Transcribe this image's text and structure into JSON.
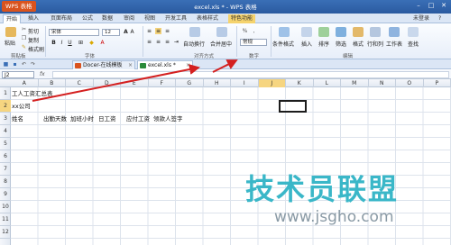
{
  "window": {
    "title": "excel.xls * - WPS 表格",
    "app_button": "WPS 表格"
  },
  "menu_tabs": [
    "开始",
    "插入",
    "页面布局",
    "公式",
    "数据",
    "审阅",
    "视图",
    "开发工具",
    "表格样式",
    "特色功能"
  ],
  "menu_right": [
    "未登录",
    "?"
  ],
  "ribbon": {
    "paste": "粘贴",
    "cut": "剪切",
    "copy": "复制",
    "format_painter": "格式刷",
    "font_name": "宋体",
    "font_size": "12",
    "wrap": "自动换行",
    "merge": "合并居中",
    "number_format": "常规",
    "cond_format": "条件格式",
    "insert_row": "插入",
    "sort": "排序",
    "filter": "筛选",
    "format": "格式",
    "row_col": "行和列",
    "sheet": "工作表",
    "find": "查找",
    "groups": {
      "clipboard": "剪贴板",
      "font": "字体",
      "align": "对齐方式",
      "number": "数字",
      "edit": "编辑"
    }
  },
  "doc_tabs": [
    {
      "label": "Docer-在线模板"
    },
    {
      "label": "excel.xls *"
    }
  ],
  "formula_bar": {
    "name_box": "J2",
    "fx": "fx",
    "value": ""
  },
  "columns": [
    "A",
    "B",
    "C",
    "D",
    "E",
    "F",
    "G",
    "H",
    "I",
    "J",
    "K",
    "L",
    "M",
    "N",
    "O",
    "P"
  ],
  "rows": [
    "1",
    "2",
    "3",
    "4",
    "5",
    "6",
    "7",
    "8",
    "9",
    "10",
    "11",
    "12"
  ],
  "cells": {
    "A1": "工人工资汇总表",
    "A2": "xx公司",
    "A3": "姓名",
    "B3": "出勤天数",
    "C3": "加班小时",
    "D3": "日工资",
    "E3": "应付工资",
    "F3": "领款人签字"
  },
  "watermark": {
    "text": "技术员联盟",
    "url": "www.jsgho.com"
  },
  "colors": {
    "title_bar": "#2a5aa0",
    "app_button": "#d9531e",
    "selected_header": "#f6d580",
    "arrow": "#d42020",
    "watermark": "#3ab7c8"
  }
}
